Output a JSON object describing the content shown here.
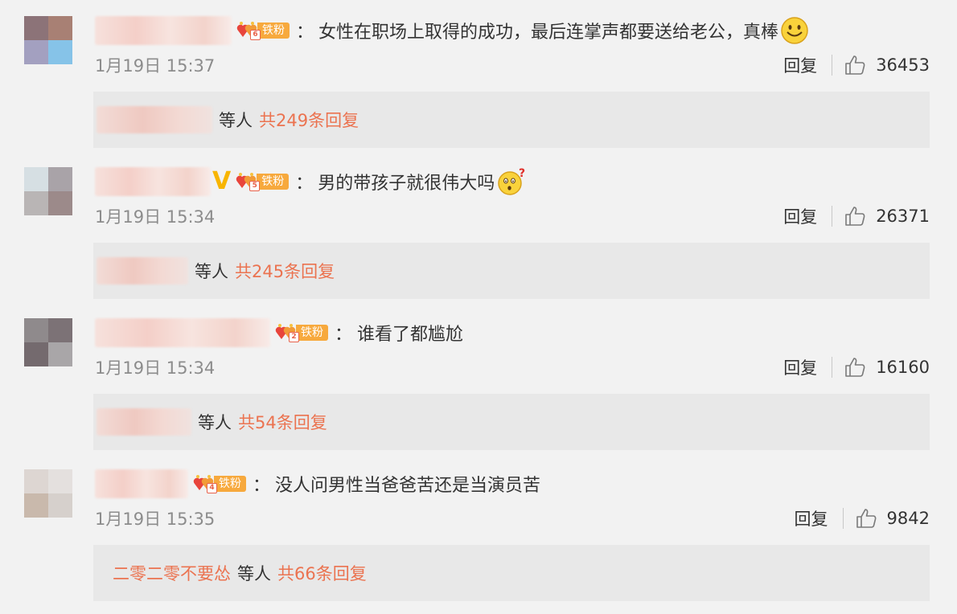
{
  "comments": [
    {
      "fan_label": "铁粉",
      "fan_level": "6",
      "colon": "：",
      "text": "女性在职场上取得的成功，最后连掌声都要送给老公，真棒",
      "emoji": "smile-emoji",
      "time": "1月19日 15:37",
      "reply_label": "回复",
      "likes": "36453",
      "replies": {
        "suffix": "等人",
        "total": "共249条回复"
      }
    },
    {
      "verified": "V",
      "fan_label": "铁粉",
      "fan_level": "5",
      "colon": "：",
      "text": "男的带孩子就很伟大吗",
      "emoji": "question-face-emoji",
      "time": "1月19日 15:34",
      "reply_label": "回复",
      "likes": "26371",
      "replies": {
        "suffix": "等人",
        "total": "共245条回复"
      }
    },
    {
      "fan_label": "铁粉",
      "fan_level": "2",
      "colon": "：",
      "text": "谁看了都尴尬",
      "time": "1月19日 15:34",
      "reply_label": "回复",
      "likes": "16160",
      "replies": {
        "suffix": "等人",
        "total": "共54条回复"
      }
    },
    {
      "fan_label": "铁粉",
      "fan_level": "4",
      "colon": "：",
      "text": "没人问男性当爸爸苦还是当演员苦",
      "time": "1月19日 15:35",
      "reply_label": "回复",
      "likes": "9842",
      "replies": {
        "replier": "二零二零不要怂",
        "suffix": "等人",
        "total": "共66条回复"
      }
    }
  ],
  "colors": {
    "background": "#f2f2f2",
    "reply_bar": "#e8e8e8",
    "link_orange": "#eb7350",
    "fan_badge": "#f7a93d",
    "verified_gold": "#f8b500"
  }
}
